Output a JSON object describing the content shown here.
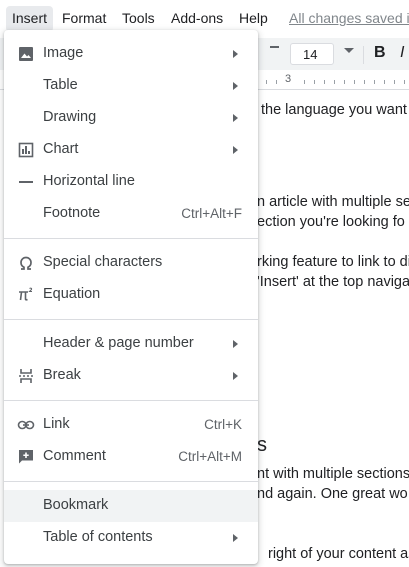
{
  "menubar": {
    "items": [
      "Insert",
      "Format",
      "Tools",
      "Add-ons",
      "Help"
    ],
    "saved_status": "All changes saved i"
  },
  "toolbar": {
    "font_size": "14",
    "bold": "B",
    "italic": "I"
  },
  "ruler": {
    "mark": "3"
  },
  "document": {
    "lines": [
      "the language you want",
      "n article with multiple sec",
      "ection you're looking fo",
      "rking feature to link to di",
      "'Insert' at the top naviga",
      "nt with multiple sections",
      "nd again. One great wo",
      "right of your content as"
    ],
    "heading_fragment": "s"
  },
  "insert_menu": {
    "items": [
      {
        "label": "Image",
        "icon": "image-icon",
        "submenu": true
      },
      {
        "label": "Table",
        "icon": "",
        "submenu": true
      },
      {
        "label": "Drawing",
        "icon": "",
        "submenu": true
      },
      {
        "label": "Chart",
        "icon": "chart-icon",
        "submenu": true
      },
      {
        "label": "Horizontal line",
        "icon": "horizontal-line-icon",
        "submenu": false
      },
      {
        "label": "Footnote",
        "icon": "",
        "shortcut": "Ctrl+Alt+F"
      },
      {
        "label": "Special characters",
        "icon": "omega-icon"
      },
      {
        "label": "Equation",
        "icon": "pi-icon"
      },
      {
        "label": "Header & page number",
        "icon": "",
        "submenu": true
      },
      {
        "label": "Break",
        "icon": "break-icon",
        "submenu": true
      },
      {
        "label": "Link",
        "icon": "link-icon",
        "shortcut": "Ctrl+K"
      },
      {
        "label": "Comment",
        "icon": "comment-icon",
        "shortcut": "Ctrl+Alt+M"
      },
      {
        "label": "Bookmark",
        "icon": "",
        "highlighted": true
      },
      {
        "label": "Table of contents",
        "icon": "",
        "submenu": true
      }
    ]
  },
  "colors": {
    "menu_hover": "#f1f3f4",
    "active_menubar": "#e8eaed",
    "icon": "#5f6368",
    "text": "#3c4043"
  }
}
